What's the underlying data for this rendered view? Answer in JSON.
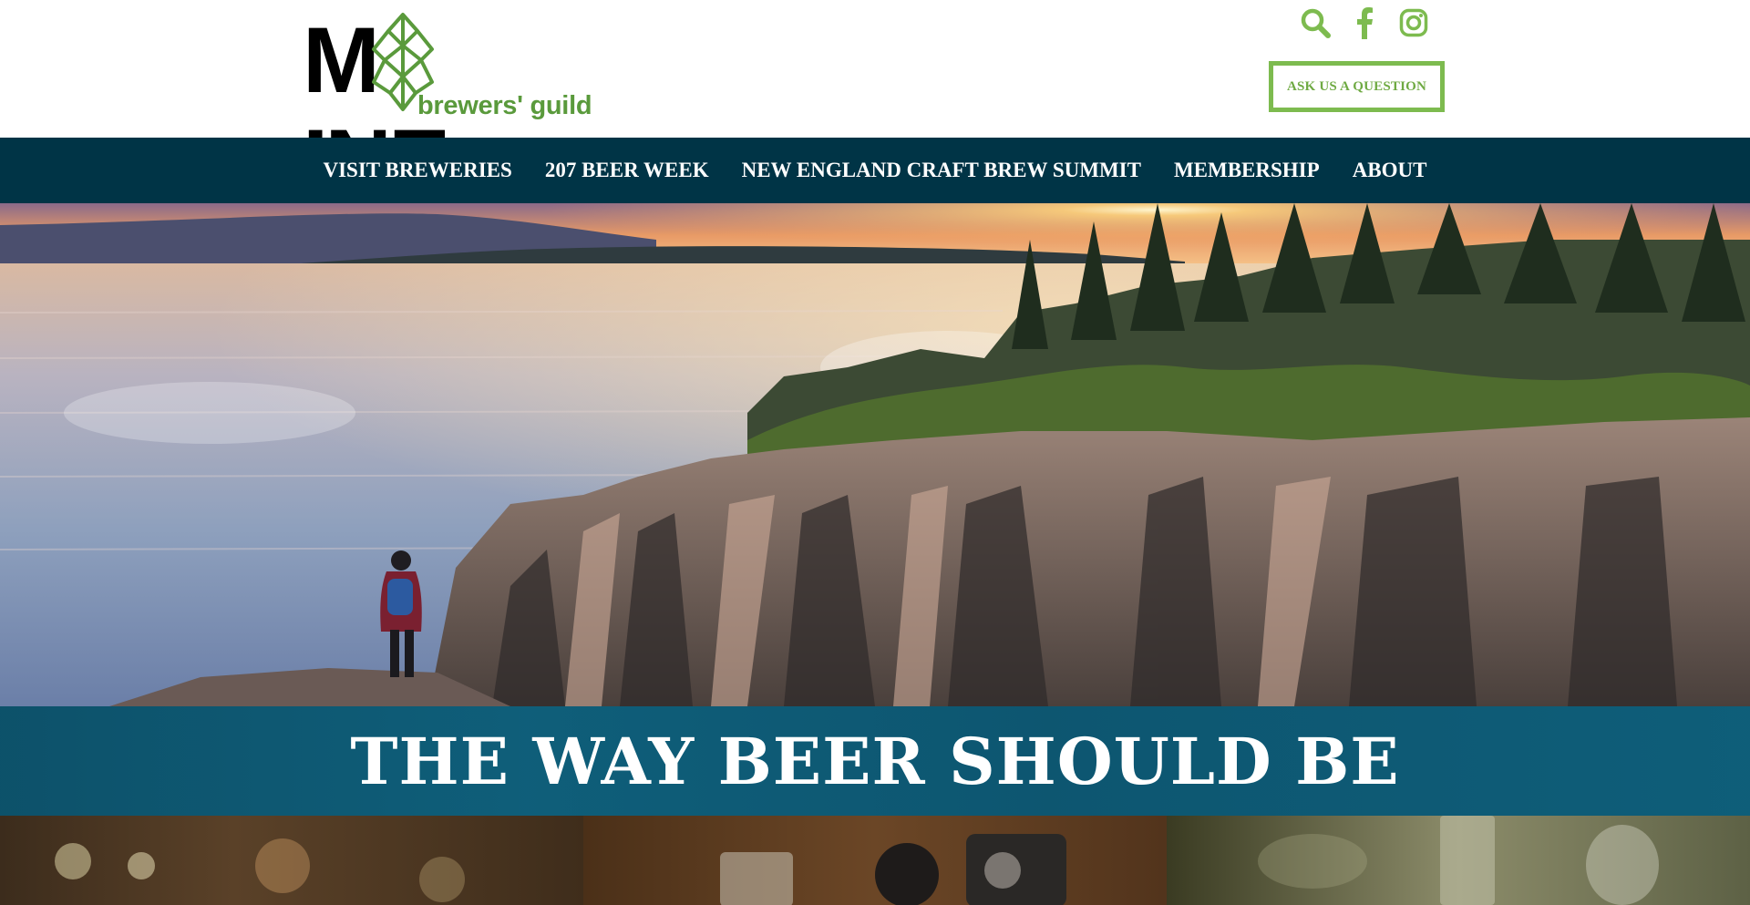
{
  "header": {
    "logo": {
      "wordmark": "MAINE",
      "subtitle": "brewers' guild"
    },
    "social_icons": [
      "search-icon",
      "facebook-icon",
      "instagram-icon"
    ],
    "ask_button_label": "ASK US A QUESTION"
  },
  "nav": {
    "items": [
      {
        "label": "VISIT BREWERIES"
      },
      {
        "label": "207 BEER WEEK"
      },
      {
        "label": "NEW ENGLAND CRAFT BREW SUMMIT"
      },
      {
        "label": "MEMBERSHIP"
      },
      {
        "label": "ABOUT"
      }
    ]
  },
  "hero": {
    "image_subject": "coastal-sunset",
    "banner_title": "THE WAY BEER SHOULD BE"
  },
  "colors": {
    "brand_green": "#6faa43",
    "nav_bg": "#003446",
    "banner_bg": "#0e5d78"
  }
}
